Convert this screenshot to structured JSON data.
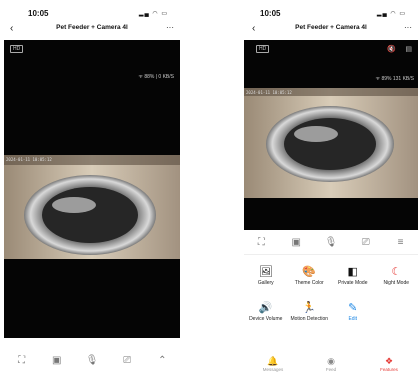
{
  "left": {
    "status": {
      "time": "10:05"
    },
    "header": {
      "title": "Pet Feeder + Camera 4l",
      "back_icon": "‹",
      "more_icon": "···"
    },
    "video": {
      "quality": "HD",
      "wifi_text": "ᯤ 88% | 0 KB/S",
      "timestamp": "2024-01-11 10:05:12"
    },
    "toolbar": [
      {
        "name": "fullscreen-icon",
        "glyph": "⛶"
      },
      {
        "name": "screenshot-icon",
        "glyph": "▣"
      },
      {
        "name": "microphone-icon",
        "glyph": "🎙"
      },
      {
        "name": "record-icon",
        "glyph": "⎚"
      },
      {
        "name": "expand-icon",
        "glyph": "⌃"
      }
    ]
  },
  "right": {
    "status": {
      "time": "10:05"
    },
    "header": {
      "title": "Pet Feeder + Camera 4l",
      "back_icon": "‹",
      "more_icon": "···"
    },
    "video": {
      "quality": "HD",
      "wifi_text": "ᯤ 89%   131 KB/S",
      "timestamp": "2024-01-11 10:05:12"
    },
    "toolbar": [
      {
        "name": "fullscreen-icon",
        "glyph": "⛶"
      },
      {
        "name": "screenshot-icon",
        "glyph": "▣"
      },
      {
        "name": "microphone-icon",
        "glyph": "🎙"
      },
      {
        "name": "record-icon",
        "glyph": "⎚"
      },
      {
        "name": "menu-icon",
        "glyph": "≡"
      }
    ],
    "features": [
      {
        "label": "Gallery",
        "glyph": "🖼",
        "color": "#111111",
        "icon_name": "gallery-icon"
      },
      {
        "label": "Theme Color",
        "glyph": "🎨",
        "color": "#111111",
        "icon_name": "palette-icon"
      },
      {
        "label": "Private Mode",
        "glyph": "◧",
        "color": "#111111",
        "icon_name": "private-mode-icon"
      },
      {
        "label": "Night Mode",
        "glyph": "☾",
        "color": "#e53935",
        "icon_name": "night-mode-icon"
      },
      {
        "label": "Device Volume",
        "glyph": "🔊",
        "color": "#111111",
        "icon_name": "speaker-icon"
      },
      {
        "label": "Motion Detection",
        "glyph": "🏃",
        "color": "#111111",
        "icon_name": "motion-icon"
      },
      {
        "label": "Edit",
        "glyph": "✎",
        "color": "#1e88e5",
        "icon_name": "edit-icon"
      }
    ],
    "bottom_nav": [
      {
        "label": "Messages",
        "glyph": "🔔",
        "active": false,
        "icon_name": "bell-icon"
      },
      {
        "label": "Feed",
        "glyph": "◉",
        "active": false,
        "icon_name": "feed-icon"
      },
      {
        "label": "Features",
        "glyph": "❖",
        "active": true,
        "icon_name": "features-icon"
      }
    ]
  }
}
